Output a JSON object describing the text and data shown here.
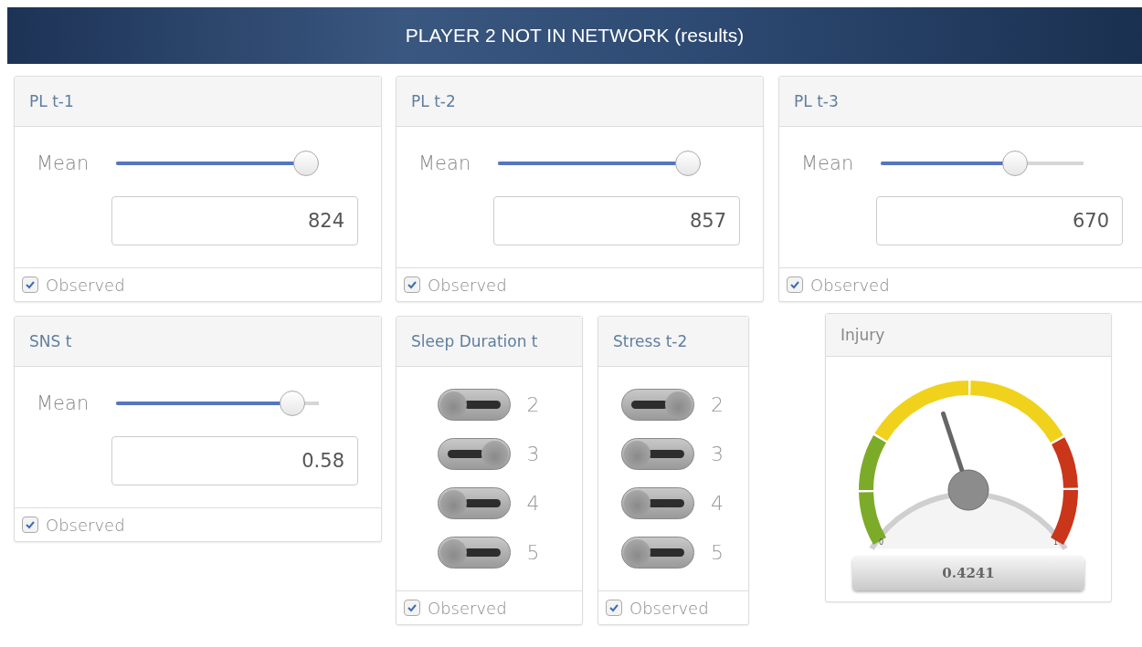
{
  "header": {
    "title": "PLAYER 2 NOT IN NETWORK (results)"
  },
  "rows": [
    [
      {
        "kind": "slider",
        "title": "PL t-1",
        "label": "Mean",
        "level": 0.98,
        "value": "824",
        "observed": true,
        "observed_label": "Observed"
      },
      {
        "kind": "slider",
        "title": "PL t-2",
        "label": "Mean",
        "level": 0.98,
        "value": "857",
        "observed": true,
        "observed_label": "Observed"
      },
      {
        "kind": "slider",
        "title": "PL t-3",
        "label": "Mean",
        "level": 0.66,
        "value": "670",
        "observed": true,
        "observed_label": "Observed"
      }
    ],
    [
      {
        "kind": "slider",
        "title": "SNS t",
        "label": "Mean",
        "level": 0.87,
        "value": "0.58",
        "observed": true,
        "observed_label": "Observed"
      },
      {
        "kind": "toggles",
        "title": "Sleep Duration t",
        "options": [
          {
            "label": "2",
            "on": false
          },
          {
            "label": "3",
            "on": true
          },
          {
            "label": "4",
            "on": false
          },
          {
            "label": "5",
            "on": false
          }
        ],
        "observed": true,
        "observed_label": "Observed"
      },
      {
        "kind": "toggles",
        "title": "Stress t-2",
        "options": [
          {
            "label": "2",
            "on": true
          },
          {
            "label": "3",
            "on": false
          },
          {
            "label": "4",
            "on": false
          },
          {
            "label": "5",
            "on": false
          }
        ],
        "observed": true,
        "observed_label": "Observed"
      },
      {
        "kind": "gauge",
        "title": "Injury",
        "reading": "0.4241",
        "min_label": "0",
        "max_label": "1"
      }
    ]
  ]
}
